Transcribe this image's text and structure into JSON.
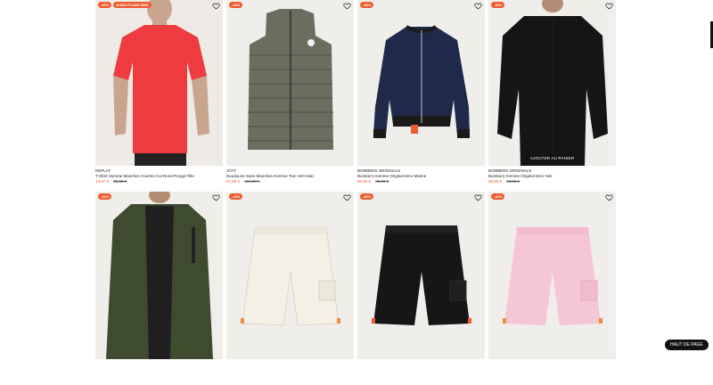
{
  "products": [
    {
      "badges": [
        "-50%",
        "BONS PLANS MEN"
      ],
      "brand": "REPLAY",
      "name": "T-Shirt Homme Manches Courtes Col Rond Rouge Fille",
      "price": "14,97 €",
      "old_price": "39,99 €",
      "image_label": "red-tshirt-model"
    },
    {
      "badges": [
        "-40%"
      ],
      "brand": "JOTT",
      "name": "Doudoune Sans Manches Homme Tom Vert Kaki",
      "price": "67,50 €",
      "old_price": "119,00 €",
      "image_label": "khaki-puffer-vest"
    },
    {
      "badges": [
        "-30%"
      ],
      "brand": "BOMBERS ORIGINALS",
      "name": "Bombers Homme Original MA1 Marine",
      "price": "90,60 €",
      "old_price": "69,99 €",
      "image_label": "navy-bomber-jacket"
    },
    {
      "badges": [
        "-30%"
      ],
      "brand": "BOMBERS ORIGINALS",
      "name": "Bombers Homme Original MA1 Noir",
      "price": "68,60 €",
      "old_price": "68,99 €",
      "image_label": "black-bomber-model",
      "cta": "AJOUTER AU PANIER"
    },
    {
      "badges": [
        "-30%"
      ],
      "brand": "",
      "name": "",
      "price": "",
      "old_price": "",
      "image_label": "green-bomber-model"
    },
    {
      "badges": [
        "-40%"
      ],
      "brand": "",
      "name": "",
      "price": "",
      "old_price": "",
      "image_label": "cream-cargo-shorts"
    },
    {
      "badges": [
        "-40%"
      ],
      "brand": "",
      "name": "",
      "price": "",
      "old_price": "",
      "image_label": "black-cargo-shorts"
    },
    {
      "badges": [
        "-40%"
      ],
      "brand": "",
      "name": "",
      "price": "",
      "old_price": "",
      "image_label": "pink-cargo-shorts"
    }
  ],
  "back_to_top": "HAUT DE PAGE",
  "colors": {
    "accent": "#ef5b2e",
    "image_bg": "#f0eeeb"
  }
}
